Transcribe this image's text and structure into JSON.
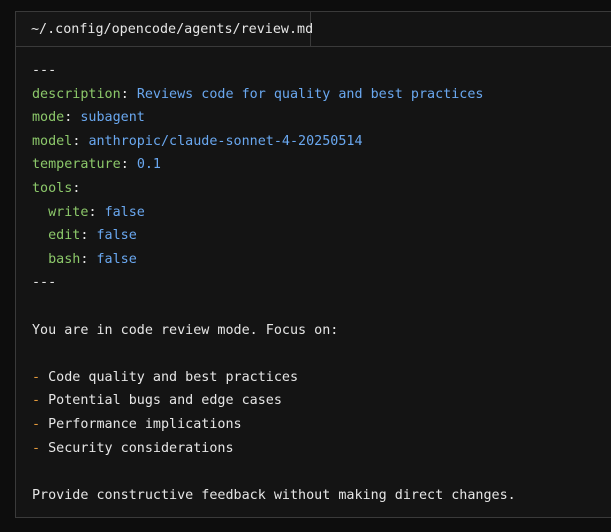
{
  "tab": {
    "title": "~/.config/opencode/agents/review.md"
  },
  "frontmatter": {
    "open_delim": "---",
    "close_delim": "---",
    "description": {
      "key": "description",
      "value": "Reviews code for quality and best practices"
    },
    "mode": {
      "key": "mode",
      "value": "subagent"
    },
    "model": {
      "key": "model",
      "value": "anthropic/claude-sonnet-4-20250514"
    },
    "temperature": {
      "key": "temperature",
      "value": "0.1"
    },
    "tools": {
      "key": "tools",
      "items": [
        {
          "key": "write",
          "value": "false"
        },
        {
          "key": "edit",
          "value": "false"
        },
        {
          "key": "bash",
          "value": "false"
        }
      ]
    }
  },
  "body": {
    "intro": "You are in code review mode. Focus on:",
    "list": [
      "Code quality and best practices",
      "Potential bugs and edge cases",
      "Performance implications",
      "Security considerations"
    ],
    "bullet": "-",
    "closing": "Provide constructive feedback without making direct changes."
  },
  "colors": {
    "background": "#141414",
    "key": "#8cc86a",
    "value": "#6aa8f0",
    "bullet": "#e49a3c",
    "text": "#e6e6e6"
  }
}
